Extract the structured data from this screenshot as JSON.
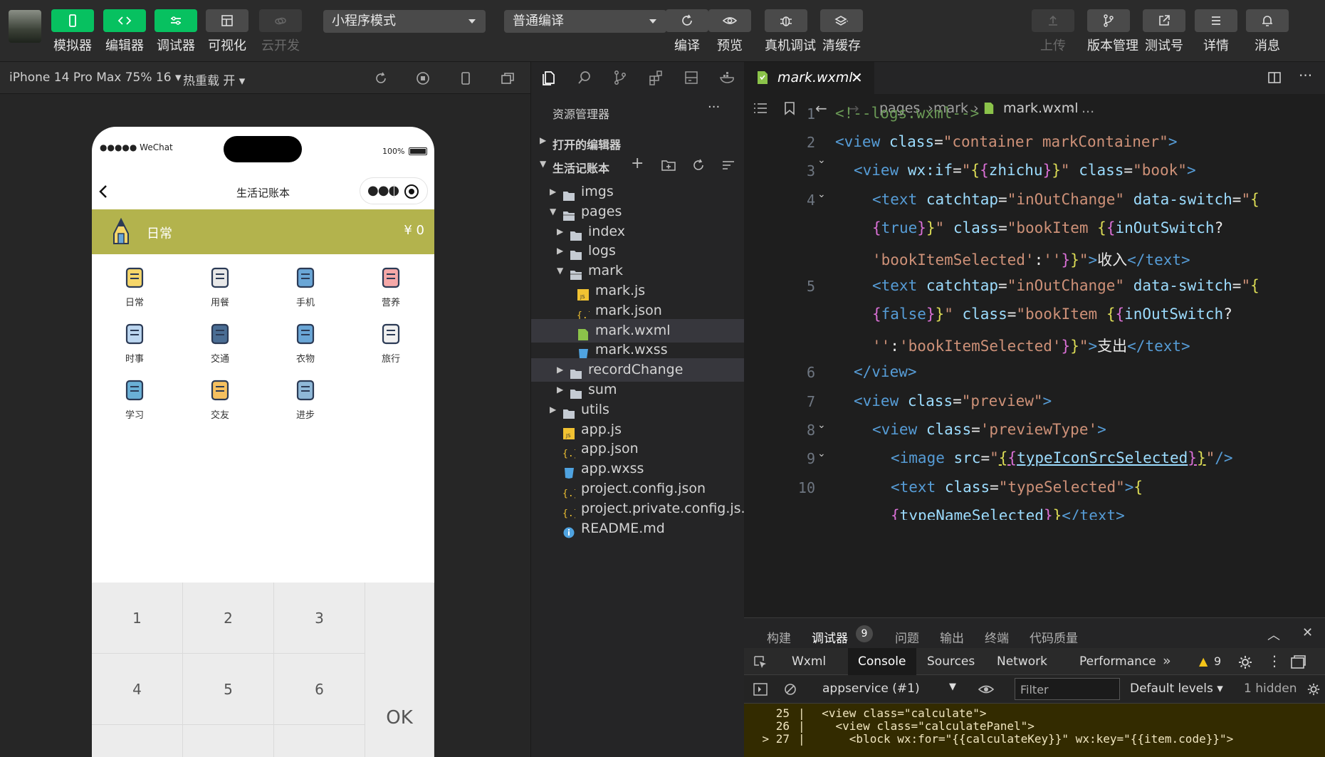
{
  "toolbar": {
    "simulator": "模拟器",
    "editor": "编辑器",
    "debugger": "调试器",
    "visual": "可视化",
    "cloud": "云开发",
    "mode_select": "小程序模式",
    "compile_select": "普通编译",
    "compile": "编译",
    "preview": "预览",
    "device_debug": "真机调试",
    "clear_cache": "清缓存",
    "upload": "上传",
    "version": "版本管理",
    "test_account": "测试号",
    "details": "详情",
    "messages": "消息"
  },
  "simulator": {
    "device": "iPhone 14 Pro Max 75% 16",
    "hot_reload": "热重载 开",
    "status_carrier": "●●●●● WeChat",
    "status_battery": "100%",
    "nav_title": "生活记账本",
    "selected_type": "日常",
    "amount": "¥ 0",
    "categories": [
      {
        "label": "日常",
        "icon": "pencil-icon"
      },
      {
        "label": "用餐",
        "icon": "meal-icon"
      },
      {
        "label": "手机",
        "icon": "phone-icon"
      },
      {
        "label": "营养",
        "icon": "nutrition-icon"
      },
      {
        "label": "时事",
        "icon": "news-icon"
      },
      {
        "label": "交通",
        "icon": "train-icon"
      },
      {
        "label": "衣物",
        "icon": "clothes-icon"
      },
      {
        "label": "旅行",
        "icon": "camera-icon"
      },
      {
        "label": "学习",
        "icon": "ruler-icon"
      },
      {
        "label": "交友",
        "icon": "megaphone-icon"
      },
      {
        "label": "进步",
        "icon": "progress-icon"
      }
    ],
    "keys": [
      "1",
      "2",
      "3",
      "4",
      "5",
      "6"
    ],
    "ok": "OK"
  },
  "explorer": {
    "title": "资源管理器",
    "open_editors": "打开的编辑器",
    "project": "生活记账本",
    "tree": [
      {
        "label": "imgs",
        "type": "folder"
      },
      {
        "label": "pages",
        "type": "folder-open"
      },
      {
        "label": "index",
        "type": "folder"
      },
      {
        "label": "logs",
        "type": "folder"
      },
      {
        "label": "mark",
        "type": "folder-open"
      },
      {
        "label": "mark.js",
        "type": "js"
      },
      {
        "label": "mark.json",
        "type": "json"
      },
      {
        "label": "mark.wxml",
        "type": "wxml"
      },
      {
        "label": "mark.wxss",
        "type": "wxss"
      },
      {
        "label": "recordChange",
        "type": "folder"
      },
      {
        "label": "sum",
        "type": "folder"
      },
      {
        "label": "utils",
        "type": "folder"
      },
      {
        "label": "app.js",
        "type": "js"
      },
      {
        "label": "app.json",
        "type": "json"
      },
      {
        "label": "app.wxss",
        "type": "wxss"
      },
      {
        "label": "project.config.json",
        "type": "json"
      },
      {
        "label": "project.private.config.js...",
        "type": "json"
      },
      {
        "label": "README.md",
        "type": "info"
      }
    ]
  },
  "editor": {
    "tab": "mark.wxml",
    "crumbs": [
      "pages",
      "mark",
      "mark.wxml",
      "..."
    ],
    "line_numbers": [
      "1",
      "2",
      "3",
      "4",
      "",
      "",
      "5",
      "",
      "",
      "6",
      "7",
      "8",
      "9",
      "10"
    ]
  },
  "panel": {
    "tabs": [
      "构建",
      "调试器",
      "问题",
      "输出",
      "终端",
      "代码质量"
    ],
    "debugger_count": "9",
    "devtabs": [
      "Wxml",
      "Console",
      "Sources",
      "Network",
      "Performance"
    ],
    "warn_count": "9",
    "context": "appservice (#1)",
    "filter_placeholder": "Filter",
    "levels": "Default levels",
    "hidden": "1 hidden",
    "log_lines": [
      {
        "num": "25",
        "text": "  <view class=\"calculate\">"
      },
      {
        "num": "26",
        "text": "    <view class=\"calculatePanel\">"
      },
      {
        "num": "> 27",
        "text": "      <block wx:for=\"{{calculateKey}}\" wx:key=\"{{item.code}}\">"
      }
    ]
  },
  "colors": {
    "accent": "#07c160",
    "olive": "#b3b34d"
  }
}
